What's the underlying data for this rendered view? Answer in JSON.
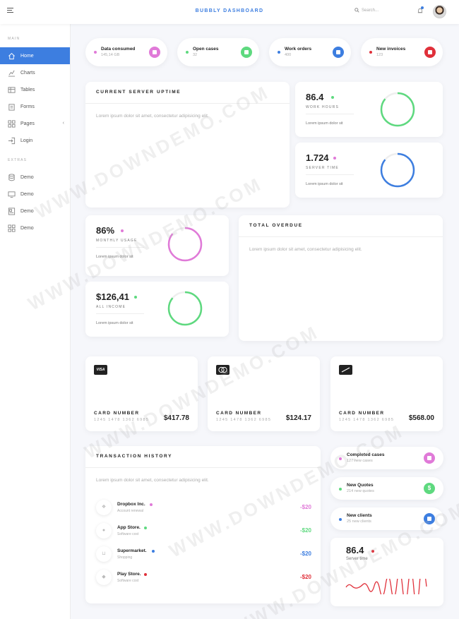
{
  "topbar": {
    "title": "BUBBLY DASHBOARD",
    "search_placeholder": "Search..."
  },
  "sidebar": {
    "main_heading": "MAIN",
    "extras_heading": "EXTRAS",
    "items": [
      {
        "label": "Home",
        "icon": "home-icon"
      },
      {
        "label": "Charts",
        "icon": "chart-icon"
      },
      {
        "label": "Tables",
        "icon": "table-icon"
      },
      {
        "label": "Forms",
        "icon": "clipboard-icon"
      },
      {
        "label": "Pages",
        "icon": "grid-icon"
      },
      {
        "label": "Login",
        "icon": "login-icon"
      }
    ],
    "extras": [
      {
        "label": "Demo",
        "icon": "database-icon"
      },
      {
        "label": "Demo",
        "icon": "monitor-icon"
      },
      {
        "label": "Demo",
        "icon": "columns-icon"
      },
      {
        "label": "Demo",
        "icon": "grid-icon"
      }
    ]
  },
  "summary": [
    {
      "title": "Data consumed",
      "value": "145,14 GB",
      "color": "#e07ad8"
    },
    {
      "title": "Open cases",
      "value": "32",
      "color": "#5ed97f"
    },
    {
      "title": "Work orders",
      "value": "400",
      "color": "#3d7ee0"
    },
    {
      "title": "New invoices",
      "value": "123",
      "color": "#e0303a"
    }
  ],
  "uptime": {
    "title": "CURRENT SERVER UPTIME",
    "text": "Lorem ipsum dolor sit amet, consectetur adipisicing elit."
  },
  "work_hours": {
    "value": "86.4",
    "label": "WORK HOURS",
    "foot": "Lorem ipsum dolor sit",
    "progress": 0.86,
    "color": "#5ed97f"
  },
  "server_time": {
    "value": "1.724",
    "label": "SERVER TIME",
    "foot": "Lorem ipsum dolor sit",
    "progress": 0.86,
    "color": "#3d7ee0"
  },
  "monthly_usage": {
    "value": "86%",
    "label": "MONTHLY USAGE",
    "foot": "Lorem ipsum dolor sit",
    "progress": 0.86,
    "color": "#e07ad8"
  },
  "income": {
    "value": "$126,41",
    "label": "ALL INCOME",
    "foot": "Lorem ipsum dolor sit",
    "progress": 0.86,
    "color": "#5ed97f"
  },
  "overdue": {
    "title": "TOTAL OVERDUE",
    "text": "Lorem ipsum dolor sit amet, consectetur adipisicing elit."
  },
  "cards": [
    {
      "logo": "VISA",
      "label": "CARD NUMBER",
      "digits": "1245 1478 1362 6985",
      "amount": "$417.78"
    },
    {
      "logo": "MC",
      "label": "CARD NUMBER",
      "digits": "1245 1478 1362 6985",
      "amount": "$124.17"
    },
    {
      "logo": "",
      "label": "CARD NUMBER",
      "digits": "1245 1478 1362 6985",
      "amount": "$568.00"
    }
  ],
  "transactions": {
    "title": "TRANSACTION HISTORY",
    "text": "Lorem ipsum dolor sit amet, consectetur adipisicing elit.",
    "rows": [
      {
        "name": "Dropbox Inc.",
        "sub": "Account renewal",
        "amount": "-$20",
        "color": "#e07ad8"
      },
      {
        "name": "App Store.",
        "sub": "Software cost",
        "amount": "-$20",
        "color": "#5ed97f"
      },
      {
        "name": "Supermarket.",
        "sub": "Shopping",
        "amount": "-$20",
        "color": "#3d7ee0"
      },
      {
        "name": "Play Store.",
        "sub": "Software cost",
        "amount": "-$20",
        "color": "#e0303a"
      }
    ]
  },
  "side_stats": [
    {
      "title": "Completed cases",
      "sub": "127 new cases",
      "color": "#e07ad8"
    },
    {
      "title": "New Quotes",
      "sub": "214 new quotes",
      "color": "#5ed97f"
    },
    {
      "title": "New clients",
      "sub": "25 new clients",
      "color": "#3d7ee0"
    }
  ],
  "server_mini": {
    "value": "86.4",
    "label": "Server time",
    "color": "#e0303a"
  },
  "watermark": "WWW.DOWNDEMO.COM"
}
